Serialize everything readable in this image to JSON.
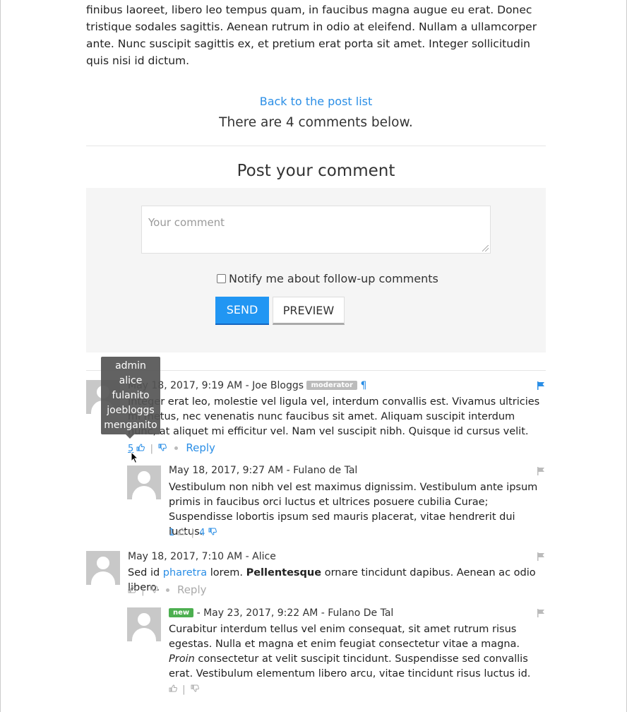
{
  "post": {
    "body": "finibus laoreet, libero leo tempus quam, in faucibus magna augue eu erat. Donec tristique sodales sagittis. Aenean rutrum in odio at eleifend. Nullam a ullamcorper ante. Nunc suscipit sagittis ex, et pretium erat porta sit amet. Integer sollicitudin quis nisi id dictum.",
    "back_link": "Back to the post list",
    "comment_count_text": "There are 4 comments below."
  },
  "form": {
    "title": "Post your comment",
    "placeholder": "Your comment",
    "notify_label": "Notify me about follow-up comments",
    "send_label": "SEND",
    "preview_label": "PREVIEW"
  },
  "tooltip": {
    "users": [
      "admin",
      "alice",
      "fulanito",
      "joebloggs",
      "menganito"
    ]
  },
  "comments": [
    {
      "date": "May 18, 2017, 9:19 AM",
      "author": "Joe Bloggs",
      "badge": "moderator",
      "permalink": "¶",
      "text": "Integer erat leo, molestie vel ligula vel, interdum convallis est. Vivamus ultricies mi metus, nec venenatis nunc faucibus sit amet. Aliquam suscipit interdum nunc, at aliquet mi efficitur vel. Nam vel suscipit nibh. Quisque id cursus velit.",
      "likes": "5",
      "dislikes": "",
      "reply": "Reply",
      "flag_color": "#2a8ee6"
    },
    {
      "date": "May 18, 2017, 9:27 AM",
      "author": "Fulano de Tal",
      "text": "Vestibulum non nibh vel est maximus dignissim. Vestibulum ante ipsum primis in faucibus orci luctus et ultrices posuere cubilia Curae; Suspendisse lobortis ipsum sed mauris placerat, vitae hendrerit dui luctus.",
      "likes": "1",
      "dislikes": "4",
      "flag_color": "#bbbbbb"
    },
    {
      "date": "May 18, 2017, 7:10 AM",
      "author": "Alice",
      "text_parts": [
        "Sed id ",
        "pharetra",
        " lorem. ",
        "Pellentesque",
        " ornare tincidunt dapibus. Aenean ac odio libero."
      ],
      "reply": "Reply",
      "flag_color": "#bbbbbb"
    },
    {
      "badge": "new",
      "date": "May 23, 2017, 9:22 AM",
      "author": "Fulano De Tal",
      "text_parts": [
        "Curabitur interdum tellus vel enim consequat, sit amet rutrum risus egestas. Nulla et magna et enim feugiat consectetur vitae a magna. ",
        "Proin",
        " consectetur at velit suscipit tincidunt. Suspendisse sed convallis erat. Vestibulum elementum libero arcu, vitae tincidunt risus luctus id."
      ],
      "flag_color": "#bbbbbb"
    }
  ]
}
